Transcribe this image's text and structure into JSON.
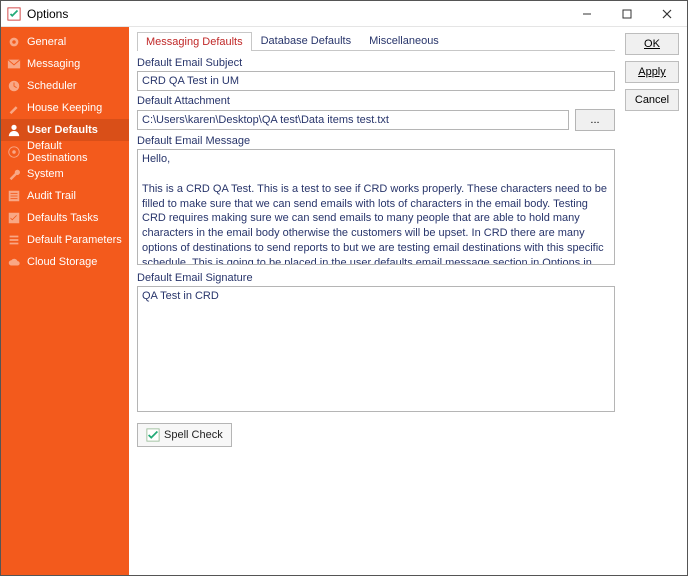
{
  "window": {
    "title": "Options"
  },
  "sidebar": {
    "items": [
      {
        "label": "General"
      },
      {
        "label": "Messaging"
      },
      {
        "label": "Scheduler"
      },
      {
        "label": "House Keeping"
      },
      {
        "label": "User Defaults"
      },
      {
        "label": "Default Destinations"
      },
      {
        "label": "System"
      },
      {
        "label": "Audit Trail"
      },
      {
        "label": "Defaults Tasks"
      },
      {
        "label": "Default Parameters"
      },
      {
        "label": "Cloud Storage"
      }
    ],
    "selected_index": 4
  },
  "tabs": {
    "items": [
      {
        "label": "Messaging Defaults"
      },
      {
        "label": "Database Defaults"
      },
      {
        "label": "Miscellaneous"
      }
    ],
    "active_index": 0
  },
  "fields": {
    "subject_label": "Default Email Subject",
    "subject_value": "CRD QA Test in UM",
    "attachment_label": "Default Attachment",
    "attachment_value": "C:\\Users\\karen\\Desktop\\QA test\\Data items test.txt",
    "browse_label": "...",
    "message_label": "Default Email Message",
    "message_value": "Hello,\n\nThis is a CRD QA Test. This is a test to see if CRD works properly. These characters need to be filled to make sure that we can send emails with lots of characters in the email body. Testing CRD requires making sure we can send emails to many people that are able to hold many characters in the email body otherwise the customers will be upset. In CRD there are many options of destinations to send reports to but we are testing email destinations with this specific schedule. This is going to be placed in the user defaults email message section in Options in CRD.",
    "signature_label": "Default Email Signature",
    "signature_value": "QA Test in CRD",
    "spell_check": "Spell Check"
  },
  "buttons": {
    "ok": "OK",
    "apply": "Apply",
    "cancel": "Cancel"
  }
}
